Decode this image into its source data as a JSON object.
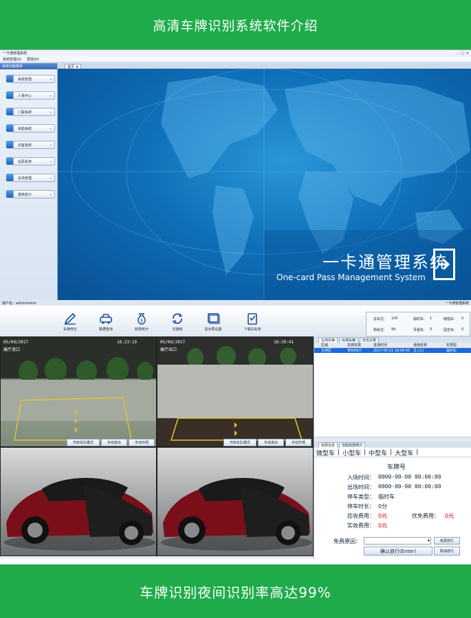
{
  "top_banner": {
    "title": "高清车牌识别系统软件介绍"
  },
  "bottom_banner": {
    "text": "车牌识别夜间识别率高达99%"
  },
  "window": {
    "title": "一卡通管理系统",
    "menu": [
      "系统管理(S)",
      "帮助(H)"
    ],
    "sidebar_title": "系统功能菜单",
    "sidebar_items": [
      "系统管理",
      "人事中心",
      "门禁系统",
      "考勤系统",
      "访客系统",
      "巡更系统",
      "车场管理",
      "报表统计"
    ],
    "tab_label": "首页",
    "hero_title": "一卡通管理系统",
    "hero_subtitle": "One-card Pass Management System",
    "status_user": "用户名：admintrator",
    "status_right": "一卡通管理系统"
  },
  "parking": {
    "toolbar": [
      {
        "label": "车牌修正",
        "icon": "pen-icon"
      },
      {
        "label": "数据查询",
        "icon": "car-icon"
      },
      {
        "label": "收费统计",
        "icon": "money-bag-icon"
      },
      {
        "label": "交接班",
        "icon": "refresh-icon"
      },
      {
        "label": "显示屏设置",
        "icon": "screen-icon"
      },
      {
        "label": "下载白名单",
        "icon": "download-list-icon"
      }
    ],
    "stats": {
      "total_label": "总车位:",
      "total": "100",
      "temp_label": "临时车:",
      "temp": "1",
      "storage_label": "储值车:",
      "storage": "0",
      "remain_label": "剩余位:",
      "remain": "99",
      "monthly_label": "月租车:",
      "monthly": "0",
      "free_label": "固定车:",
      "free": "0"
    },
    "cameras": [
      {
        "date": "05/09/2017",
        "time": "16:23:19",
        "label": "展厅进口",
        "buttons": [
          "开启车队模式",
          "手动进出",
          "手动开闸"
        ]
      },
      {
        "date": "05/09/2017",
        "time": "16:20:41",
        "label": "展厅出口",
        "buttons": [
          "开启车队模式",
          "手动进出",
          "手动开闸"
        ]
      }
    ],
    "records": {
      "tabs": [
        "在场车辆",
        "出场车辆",
        "日志记录"
      ],
      "headers": [
        "区域",
        "车牌车费",
        "进场时间",
        "通道名称",
        "车类型"
      ],
      "rows": [
        [
          "主停区",
          "粤B9007",
          "2017-05-11 16:09:43",
          "主入口",
          "临时车"
        ]
      ]
    },
    "fee_panel": {
      "tabs": [
        "收费信息",
        "当班收费统计"
      ],
      "vehicle_types": [
        "微型车",
        "小型车",
        "中型车",
        "大型车"
      ],
      "plate_label": "车牌号",
      "entry_label": "入场时间：",
      "entry_value": "0000-00-00 00:00:00",
      "exit_label": "出场时间：",
      "exit_value": "0000-00-00 00:00:00",
      "type_label": "停车类型：",
      "type_value": "临时车",
      "duration_label": "停车时长：",
      "duration_value": "0分",
      "due_label": "应收费用：",
      "due_value": "0元",
      "discount_label": "优免费用：",
      "discount_value": "0元",
      "paid_label": "实收费用：",
      "paid_value": "0元",
      "free_reason_label": "免费原因：",
      "free_button": "免费放行",
      "confirm_button": "确认放行(Enter)",
      "cancel_button": "取消放行"
    }
  },
  "colors": {
    "banner_green": "#1fab4a",
    "accent_red": "#e60000",
    "selection_blue": "#1d68d6"
  }
}
